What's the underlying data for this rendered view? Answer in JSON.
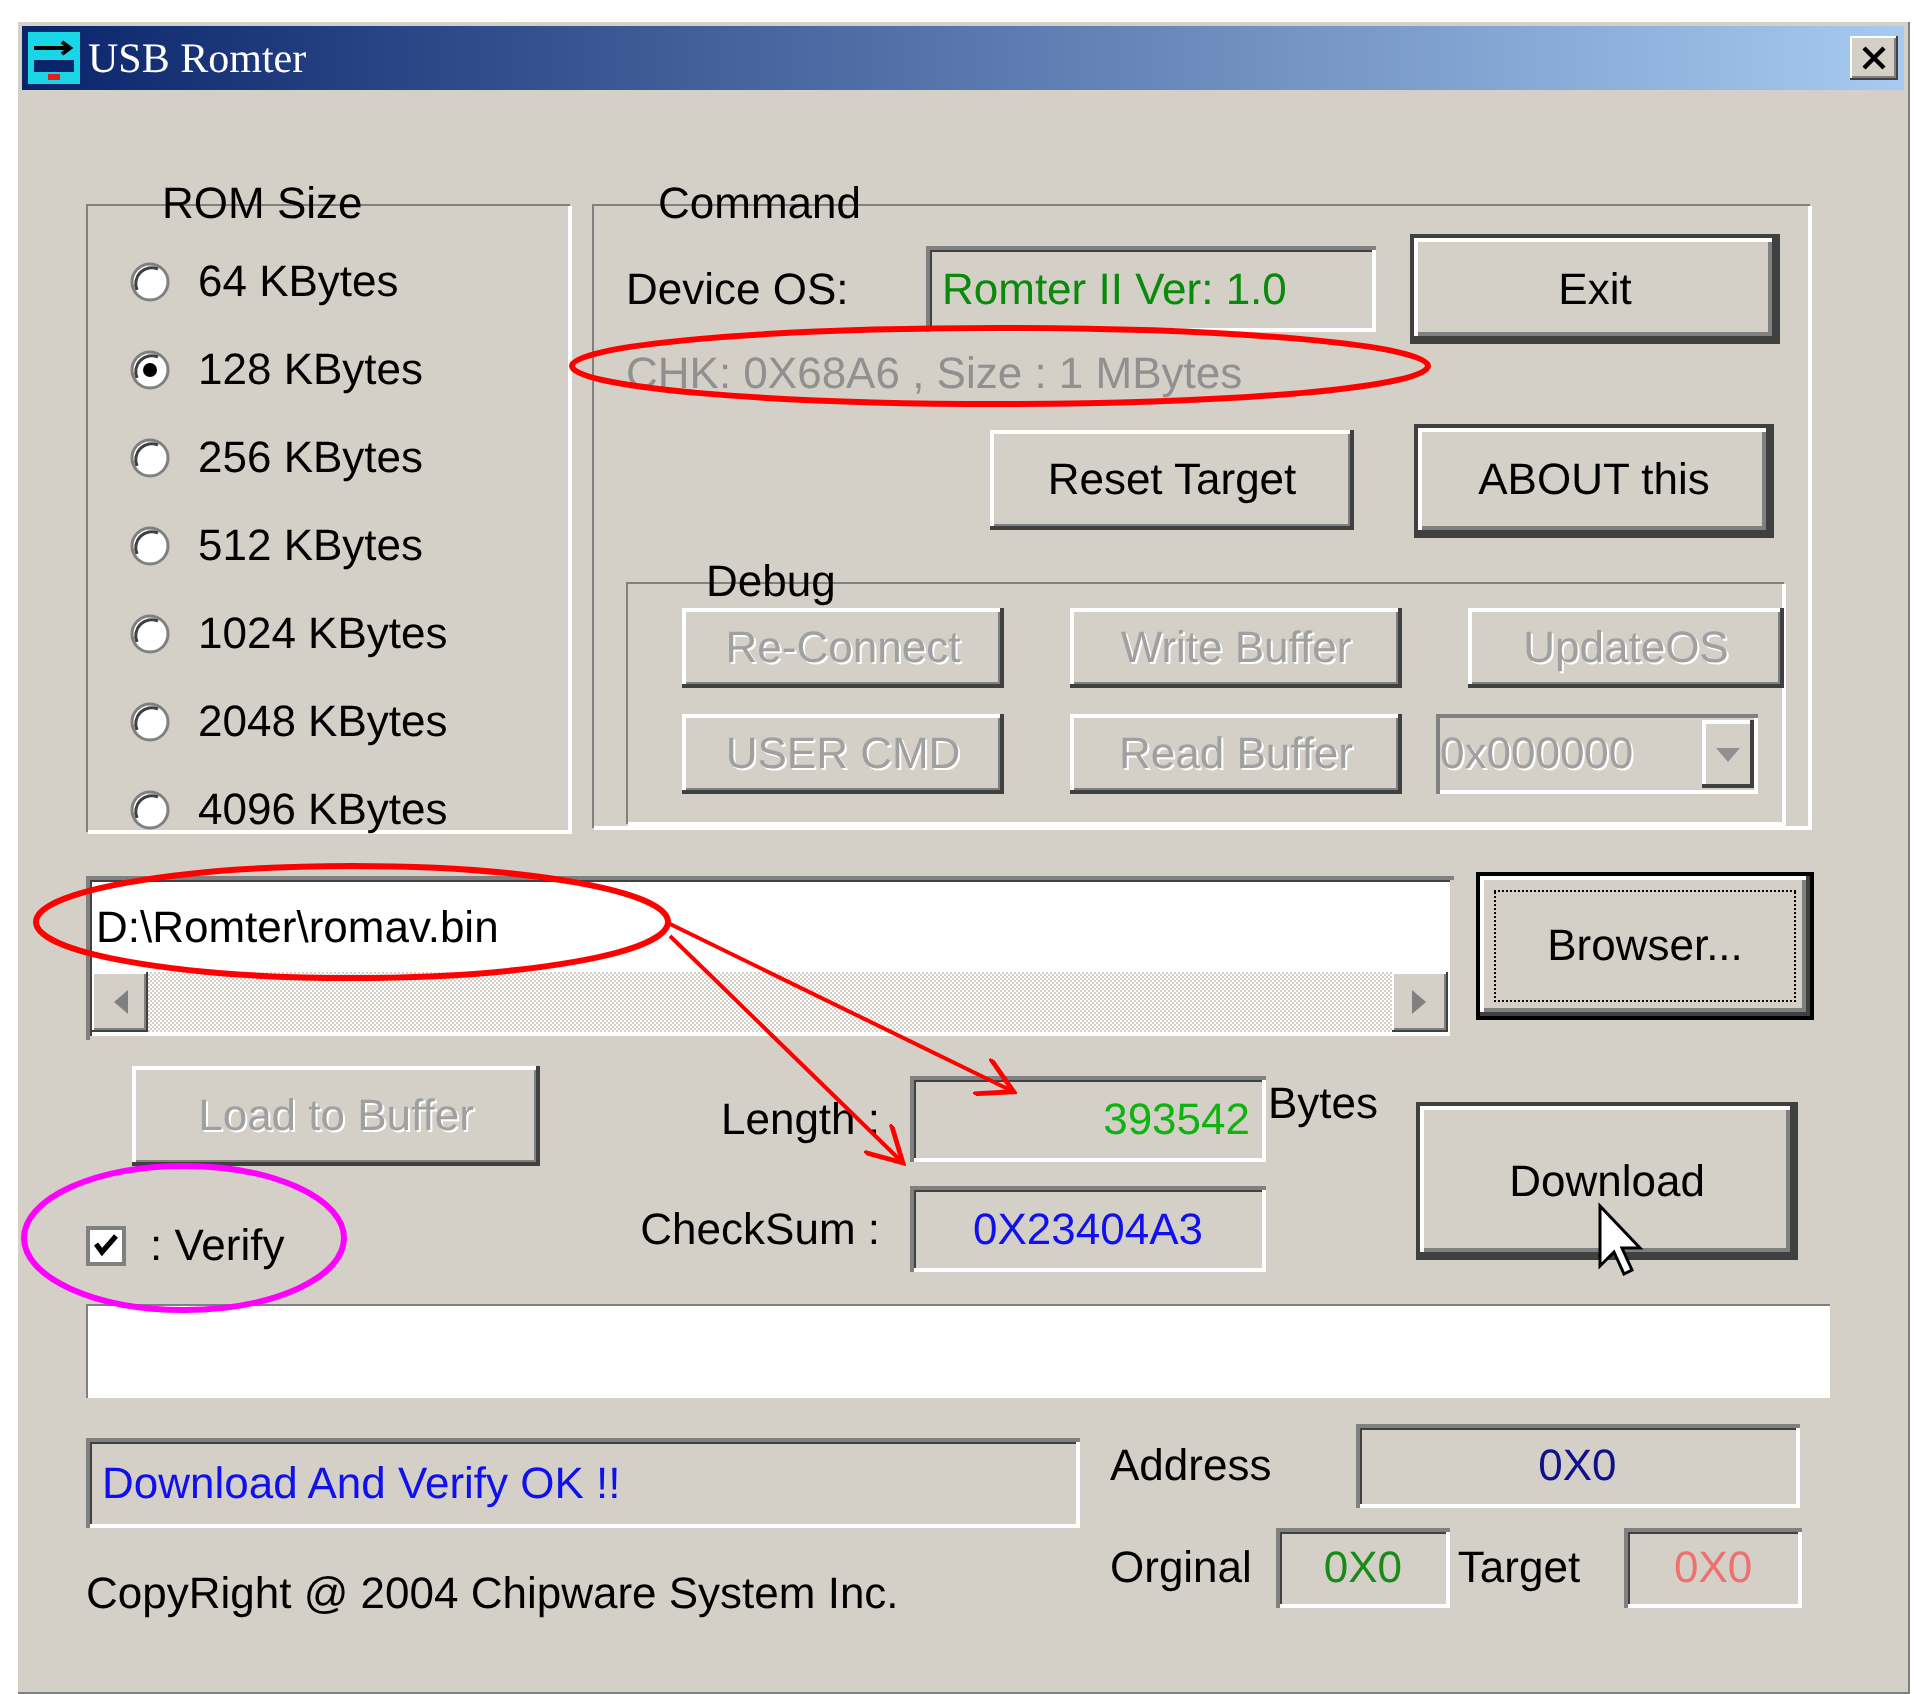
{
  "window": {
    "title": "USB Romter"
  },
  "rom_size": {
    "label": "ROM Size",
    "options": [
      {
        "label": "64 KBytes",
        "selected": false
      },
      {
        "label": "128 KBytes",
        "selected": true
      },
      {
        "label": "256 KBytes",
        "selected": false
      },
      {
        "label": "512 KBytes",
        "selected": false
      },
      {
        "label": "1024 KBytes",
        "selected": false
      },
      {
        "label": "2048 KBytes",
        "selected": false
      },
      {
        "label": "4096 KBytes",
        "selected": false
      }
    ]
  },
  "command": {
    "label": "Command",
    "device_os_label": "Device OS:",
    "device_os_value": "Romter II Ver: 1.0",
    "chk_info": "CHK: 0X68A6 , Size : 1 MBytes",
    "exit_button": {
      "label": "Exit",
      "disabled": false
    },
    "reset_button": {
      "label": "Reset Target",
      "disabled": false
    },
    "about_button": {
      "label": "ABOUT this",
      "disabled": false
    },
    "debug": {
      "label": "Debug",
      "buttons": [
        {
          "label": "Re-Connect",
          "disabled": true
        },
        {
          "label": "Write Buffer",
          "disabled": true
        },
        {
          "label": "UpdateOS",
          "disabled": true
        },
        {
          "label": "USER CMD",
          "disabled": true
        },
        {
          "label": "Read Buffer",
          "disabled": true
        }
      ],
      "address_combo": {
        "value": "0x000000",
        "disabled": true
      }
    }
  },
  "file": {
    "path": "D:\\Romter\\romav.bin",
    "browse_button": {
      "label": "Browser...",
      "disabled": false
    }
  },
  "load_button": {
    "label": "Load to Buffer",
    "disabled": true
  },
  "verify": {
    "label": ": Verify",
    "checked": true
  },
  "length": {
    "label": "Length :",
    "value": "393542",
    "unit": "Bytes"
  },
  "checksum": {
    "label": "CheckSum :",
    "value": "0X23404A3"
  },
  "download_button": {
    "label": "Download",
    "disabled": false
  },
  "status": "Download And Verify OK !!",
  "copyright": "CopyRight @ 2004 Chipware System Inc.",
  "address": {
    "label": "Address",
    "value": "0X0"
  },
  "original": {
    "label": "Orginal",
    "value": "0X0"
  },
  "target": {
    "label": "Target",
    "value": "0X0"
  }
}
